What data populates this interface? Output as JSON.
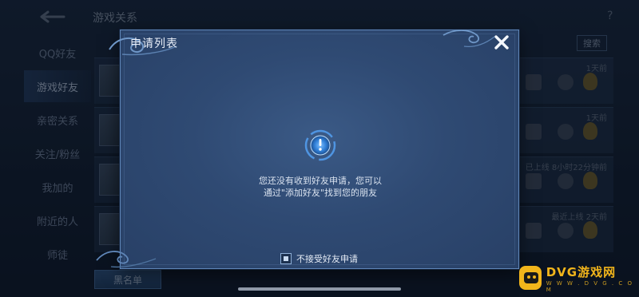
{
  "background": {
    "screen_title": "游戏关系",
    "help_icon_glyph": "?",
    "side_nav": [
      {
        "label": "QQ好友",
        "active": false
      },
      {
        "label": "游戏好友",
        "active": true
      },
      {
        "label": "亲密关系",
        "active": false
      },
      {
        "label": "关注/粉丝",
        "active": false
      },
      {
        "label": "我加的",
        "active": false
      },
      {
        "label": "附近的人",
        "active": false
      },
      {
        "label": "师徒",
        "active": false
      }
    ],
    "search_label": "搜索",
    "friend_rows": [
      {
        "status": "1天前"
      },
      {
        "status": "1天前"
      },
      {
        "status": "已上线 8小时22分钟前"
      },
      {
        "status": "最近上线 2天前"
      }
    ],
    "blacklist_label": "黑名单"
  },
  "dialog": {
    "title": "申请列表",
    "close_label": "✕",
    "empty_line1": "您还没有收到好友申请，您可以",
    "empty_line2": "通过\"添加好友\"找到您的朋友",
    "reject_label": "不接受好友申请",
    "reject_checked": true
  },
  "watermark": {
    "brand": "DVG游戏网",
    "url": "W W W . D V G . C O M"
  },
  "colors": {
    "dialog_bg": "#2f4a73",
    "dialog_border": "#5f86b8",
    "accent_gold": "#f2b51b"
  }
}
